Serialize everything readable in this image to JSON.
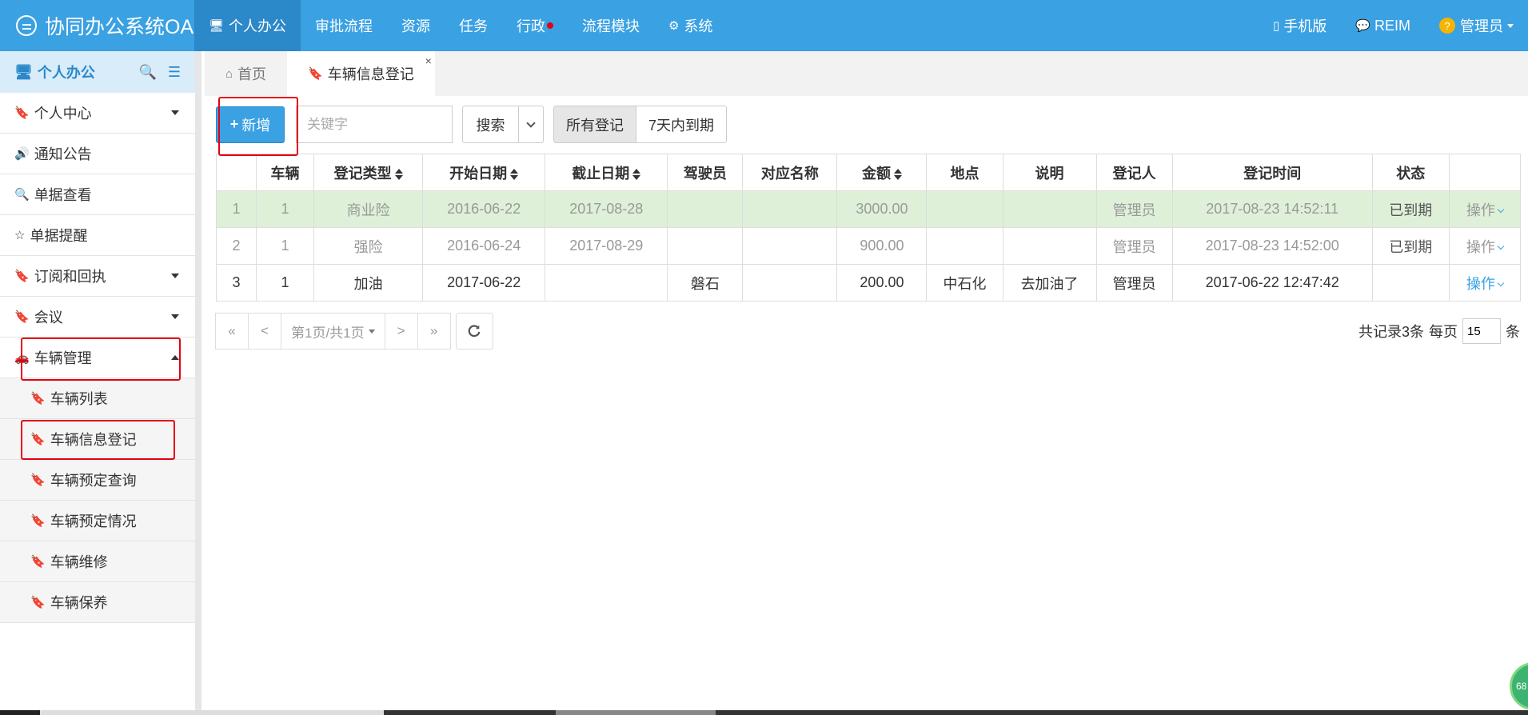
{
  "app": {
    "title": "协同办公系统OA"
  },
  "topnav": [
    {
      "label": "个人办公",
      "icon": "monitor-icon",
      "active": true
    },
    {
      "label": "审批流程"
    },
    {
      "label": "资源"
    },
    {
      "label": "任务"
    },
    {
      "label": "行政",
      "badge": true
    },
    {
      "label": "流程模块"
    },
    {
      "label": "系统",
      "icon": "gear-icon"
    }
  ],
  "topright": {
    "mobile": "手机版",
    "reim": "REIM",
    "user": "管理员"
  },
  "sidebar": {
    "title": "个人办公",
    "items": [
      {
        "label": "个人中心",
        "icon": "bookmark-icon",
        "caret": "down"
      },
      {
        "label": "通知公告",
        "icon": "volume-icon"
      },
      {
        "label": "单据查看",
        "icon": "search-icon"
      },
      {
        "label": "单据提醒",
        "icon": "star-icon"
      },
      {
        "label": "订阅和回执",
        "icon": "bookmark-icon",
        "caret": "down"
      },
      {
        "label": "会议",
        "icon": "bookmark-icon",
        "caret": "down"
      },
      {
        "label": "车辆管理",
        "icon": "car-icon",
        "caret": "up"
      }
    ],
    "subitems": [
      {
        "label": "车辆列表"
      },
      {
        "label": "车辆信息登记"
      },
      {
        "label": "车辆预定查询"
      },
      {
        "label": "车辆预定情况"
      },
      {
        "label": "车辆维修"
      },
      {
        "label": "车辆保养"
      }
    ]
  },
  "tabs": [
    {
      "label": "首页",
      "icon": "home-icon"
    },
    {
      "label": "车辆信息登记",
      "icon": "bookmark-icon",
      "close": "×"
    }
  ],
  "toolbar": {
    "add_label": "新增",
    "search_placeholder": "关键字",
    "search_label": "搜索",
    "filter_all": "所有登记",
    "filter_7days": "7天内到期"
  },
  "table": {
    "headers": [
      "",
      "车辆",
      "登记类型",
      "开始日期",
      "截止日期",
      "驾驶员",
      "对应名称",
      "金额",
      "地点",
      "说明",
      "登记人",
      "登记时间",
      "状态",
      ""
    ],
    "rows": [
      {
        "cells": [
          "1",
          "1",
          "商业险",
          "2016-06-22",
          "2017-08-28",
          "",
          "",
          "3000.00",
          "",
          "",
          "管理员",
          "2017-08-23 14:52:11",
          "已到期"
        ],
        "op": "操作"
      },
      {
        "cells": [
          "2",
          "1",
          "强险",
          "2016-06-24",
          "2017-08-29",
          "",
          "",
          "900.00",
          "",
          "",
          "管理员",
          "2017-08-23 14:52:00",
          "已到期"
        ],
        "op": "操作"
      },
      {
        "cells": [
          "3",
          "1",
          "加油",
          "2017-06-22",
          "",
          "磐石",
          "",
          "200.00",
          "中石化",
          "去加油了",
          "管理员",
          "2017-06-22 12:47:42",
          ""
        ],
        "op": "操作"
      }
    ]
  },
  "pager": {
    "first": "«",
    "prev": "<",
    "page_info": "第1页/共1页",
    "next": ">",
    "last": "»",
    "total_text": "共记录3条",
    "per_page_label": "每页",
    "per_page_value": "15",
    "unit": "条"
  },
  "float_ball": {
    "text": "68"
  },
  "colors": {
    "primary": "#3aa1e3",
    "primary_dark": "#2b88c9",
    "highlight_row": "#dff0d8",
    "annotation_red": "#e60012"
  }
}
